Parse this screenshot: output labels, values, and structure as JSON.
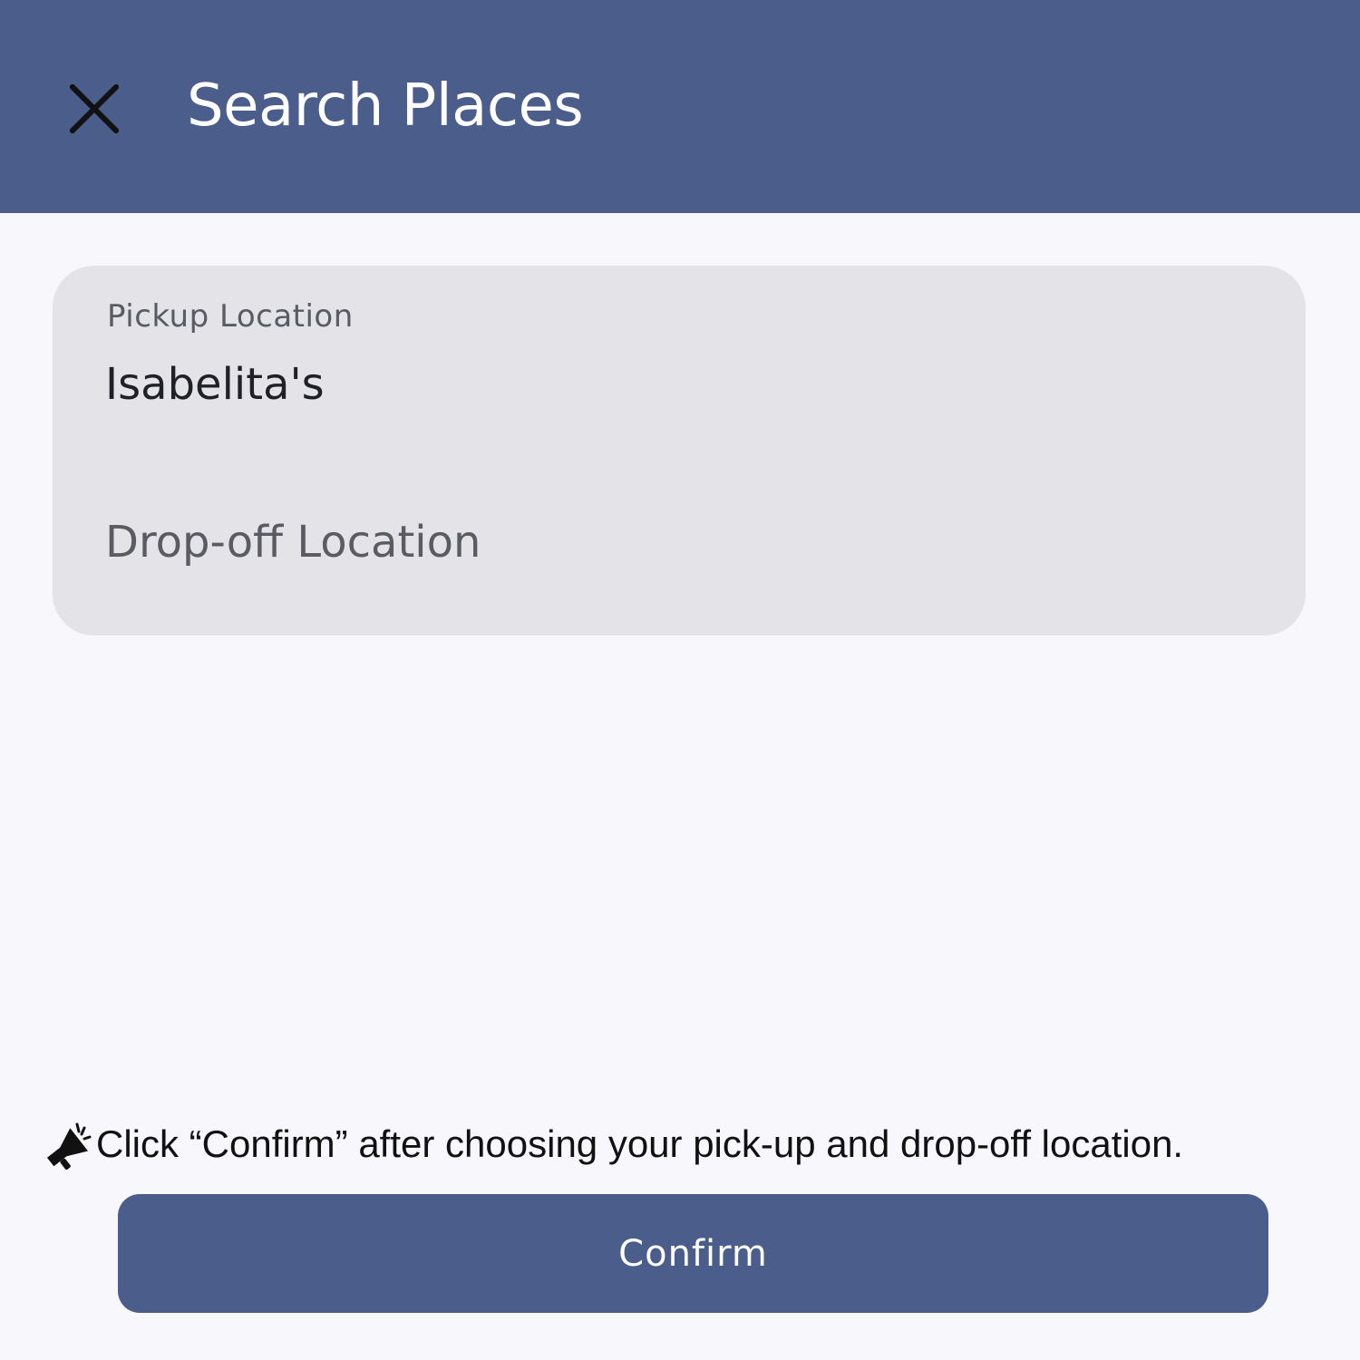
{
  "header": {
    "title": "Search Places",
    "close_icon": "close-icon",
    "background_color": "#4a5d8b"
  },
  "form": {
    "pickup": {
      "label": "Pickup Location",
      "value": "Isabelita's"
    },
    "dropoff": {
      "placeholder": "Drop-off Location",
      "value": ""
    },
    "card_color": "#e3e3e8"
  },
  "hint": {
    "icon": "megaphone-icon",
    "text": "Click “Confirm” after choosing your pick-up and drop-off location."
  },
  "confirm": {
    "label": "Confirm",
    "color": "#4a5d8b"
  }
}
